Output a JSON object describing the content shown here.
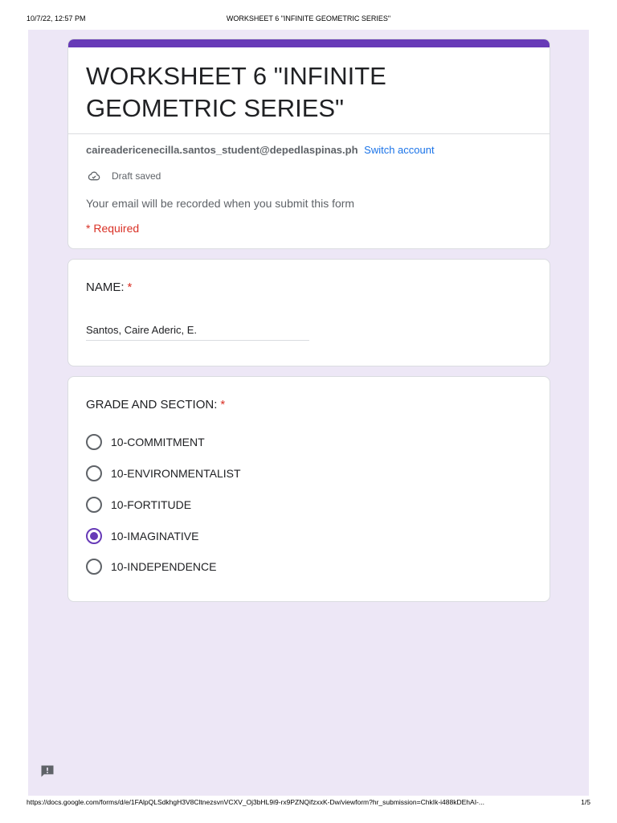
{
  "print_header": {
    "datetime": "10/7/22, 12:57 PM",
    "title": "WORKSHEET 6 \"INFINITE GEOMETRIC SERIES\""
  },
  "form": {
    "title": "WORKSHEET 6 \"INFINITE GEOMETRIC SERIES\"",
    "account_email": "caireadericenecilla.santos_student@depedlaspinas.ph",
    "switch_account_label": "Switch account",
    "draft_status": "Draft saved",
    "email_notice": "Your email will be recorded when you submit this form",
    "required_note": "* Required",
    "accent_color": "#673ab7"
  },
  "questions": {
    "name": {
      "label": "NAME:",
      "required_mark": "*",
      "answer": "Santos, Caire Aderic, E."
    },
    "grade_section": {
      "label": "GRADE AND SECTION:",
      "required_mark": "*",
      "options": [
        {
          "label": "10-COMMITMENT",
          "checked": false
        },
        {
          "label": "10-ENVIRONMENTALIST",
          "checked": false
        },
        {
          "label": "10-FORTITUDE",
          "checked": false
        },
        {
          "label": "10-IMAGINATIVE",
          "checked": true
        },
        {
          "label": "10-INDEPENDENCE",
          "checked": false
        }
      ]
    }
  },
  "icons": {
    "cloud": "cloud-check-icon",
    "feedback": "report-feedback-icon"
  },
  "print_footer": {
    "url": "https://docs.google.com/forms/d/e/1FAlpQLSdkhgH3V8CltnezsvnVCXV_Oj3bHL9i9-rx9PZNQifzxxK-Dw/viewform?hr_submission=ChkIk-i488kDEhAI-...",
    "page_number": "1/5"
  }
}
